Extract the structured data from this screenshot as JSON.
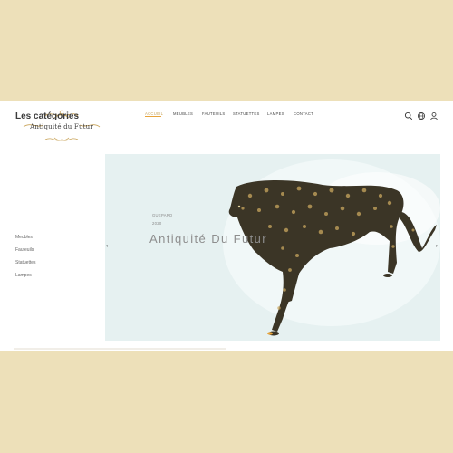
{
  "brand": {
    "logo_text": "Antiquité du Futur"
  },
  "nav": {
    "items": [
      {
        "label": "ACCUEIL",
        "active": true
      },
      {
        "label": "MEUBLES"
      },
      {
        "label": "FAUTEUILS"
      },
      {
        "label": "STATUETTES"
      },
      {
        "label": "LAMPES"
      },
      {
        "label": "CONTACT"
      }
    ]
  },
  "header_icons": [
    "search-icon",
    "globe-icon",
    "user-icon"
  ],
  "sidebar": {
    "title": "Les catégories",
    "categories": [
      "Meubles",
      "Fauteuils",
      "Statuettes",
      "Lampes"
    ]
  },
  "hero": {
    "tag": "GUEPARD",
    "year": "2020",
    "title": "Antiquité Du Futur",
    "prev_arrow": "‹",
    "next_arrow": "›"
  },
  "colors": {
    "background": "#ede0b9",
    "accent": "#e7a33a",
    "hero_bg": "#e6f1f1"
  }
}
